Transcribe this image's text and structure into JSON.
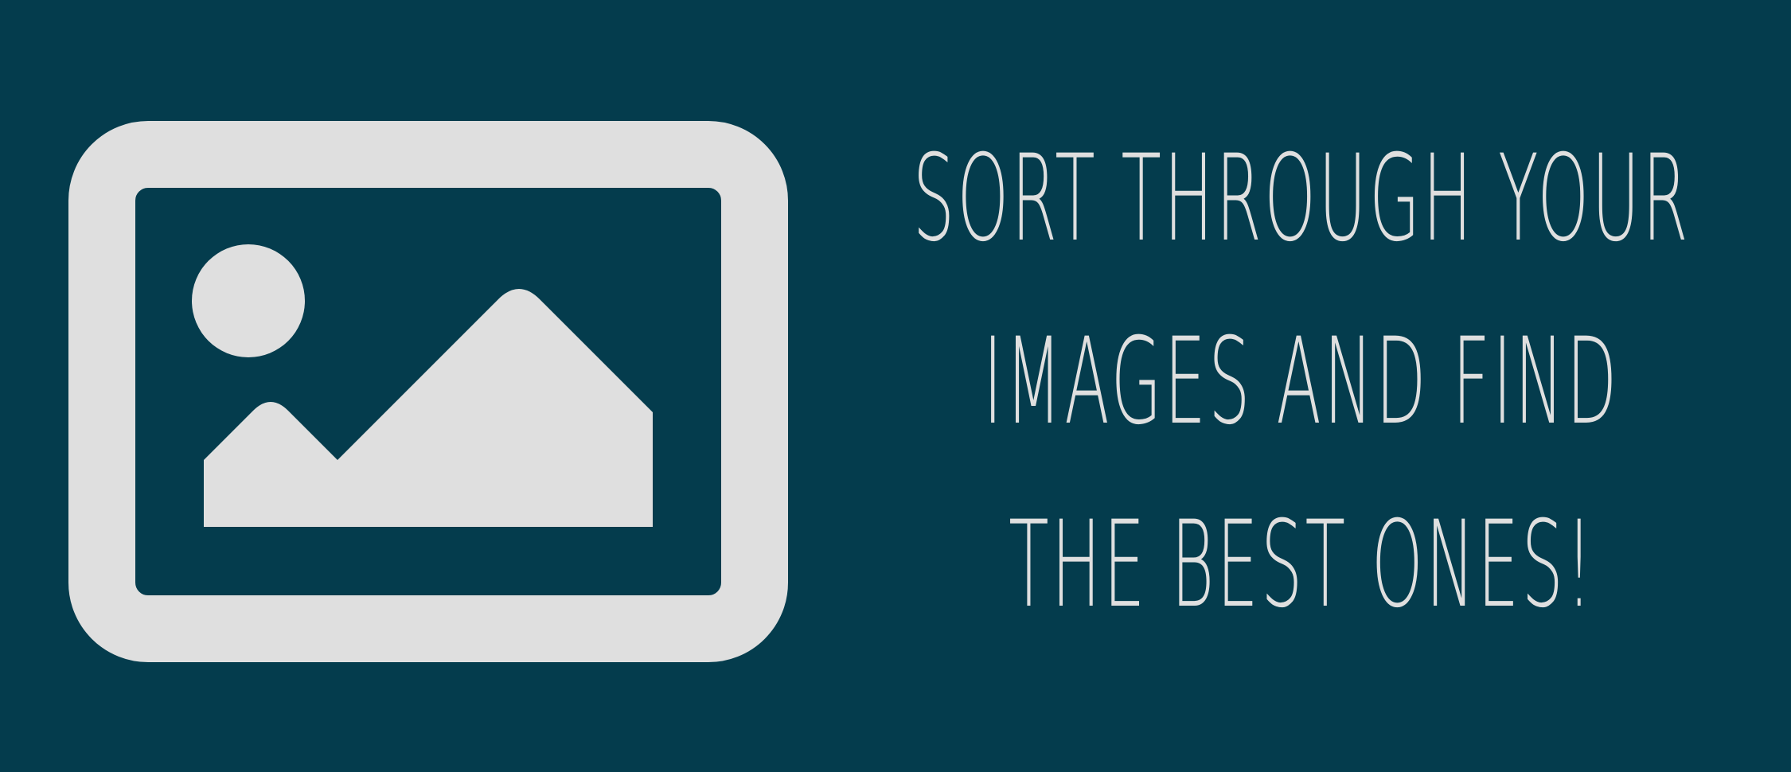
{
  "banner": {
    "background_color": "#043c4d",
    "foreground_color": "#dfdfdf",
    "icon": "image-placeholder-icon",
    "tagline_lines": [
      "SORT THROUGH YOUR",
      "IMAGES AND FIND",
      "THE BEST ONES!"
    ]
  }
}
